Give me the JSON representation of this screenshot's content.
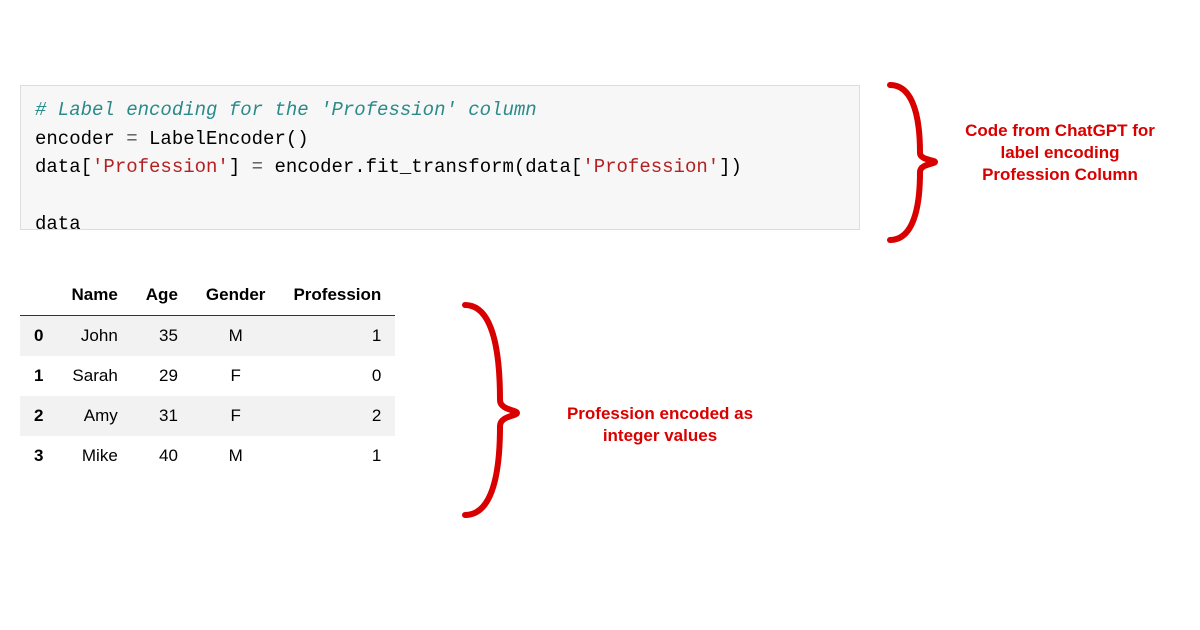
{
  "code": {
    "comment": "# Label encoding for the 'Profession' column",
    "line2_pre": "encoder ",
    "line2_eq": "=",
    "line2_post": " LabelEncoder()",
    "line3_pre": "data[",
    "line3_str1": "'Profession'",
    "line3_mid1": "] ",
    "line3_eq": "=",
    "line3_mid2": " encoder.fit_transform(data[",
    "line3_str2": "'Profession'",
    "line3_close": "])",
    "line5": "data"
  },
  "table": {
    "columns": [
      "Name",
      "Age",
      "Gender",
      "Profession"
    ],
    "rows": [
      {
        "idx": "0",
        "Name": "John",
        "Age": "35",
        "Gender": "M",
        "Profession": "1"
      },
      {
        "idx": "1",
        "Name": "Sarah",
        "Age": "29",
        "Gender": "F",
        "Profession": "0"
      },
      {
        "idx": "2",
        "Name": "Amy",
        "Age": "31",
        "Gender": "F",
        "Profession": "2"
      },
      {
        "idx": "3",
        "Name": "Mike",
        "Age": "40",
        "Gender": "M",
        "Profession": "1"
      }
    ]
  },
  "annotations": {
    "code_label": "Code from ChatGPT for label encoding Profession Column",
    "table_label": "Profession encoded as integer values"
  }
}
